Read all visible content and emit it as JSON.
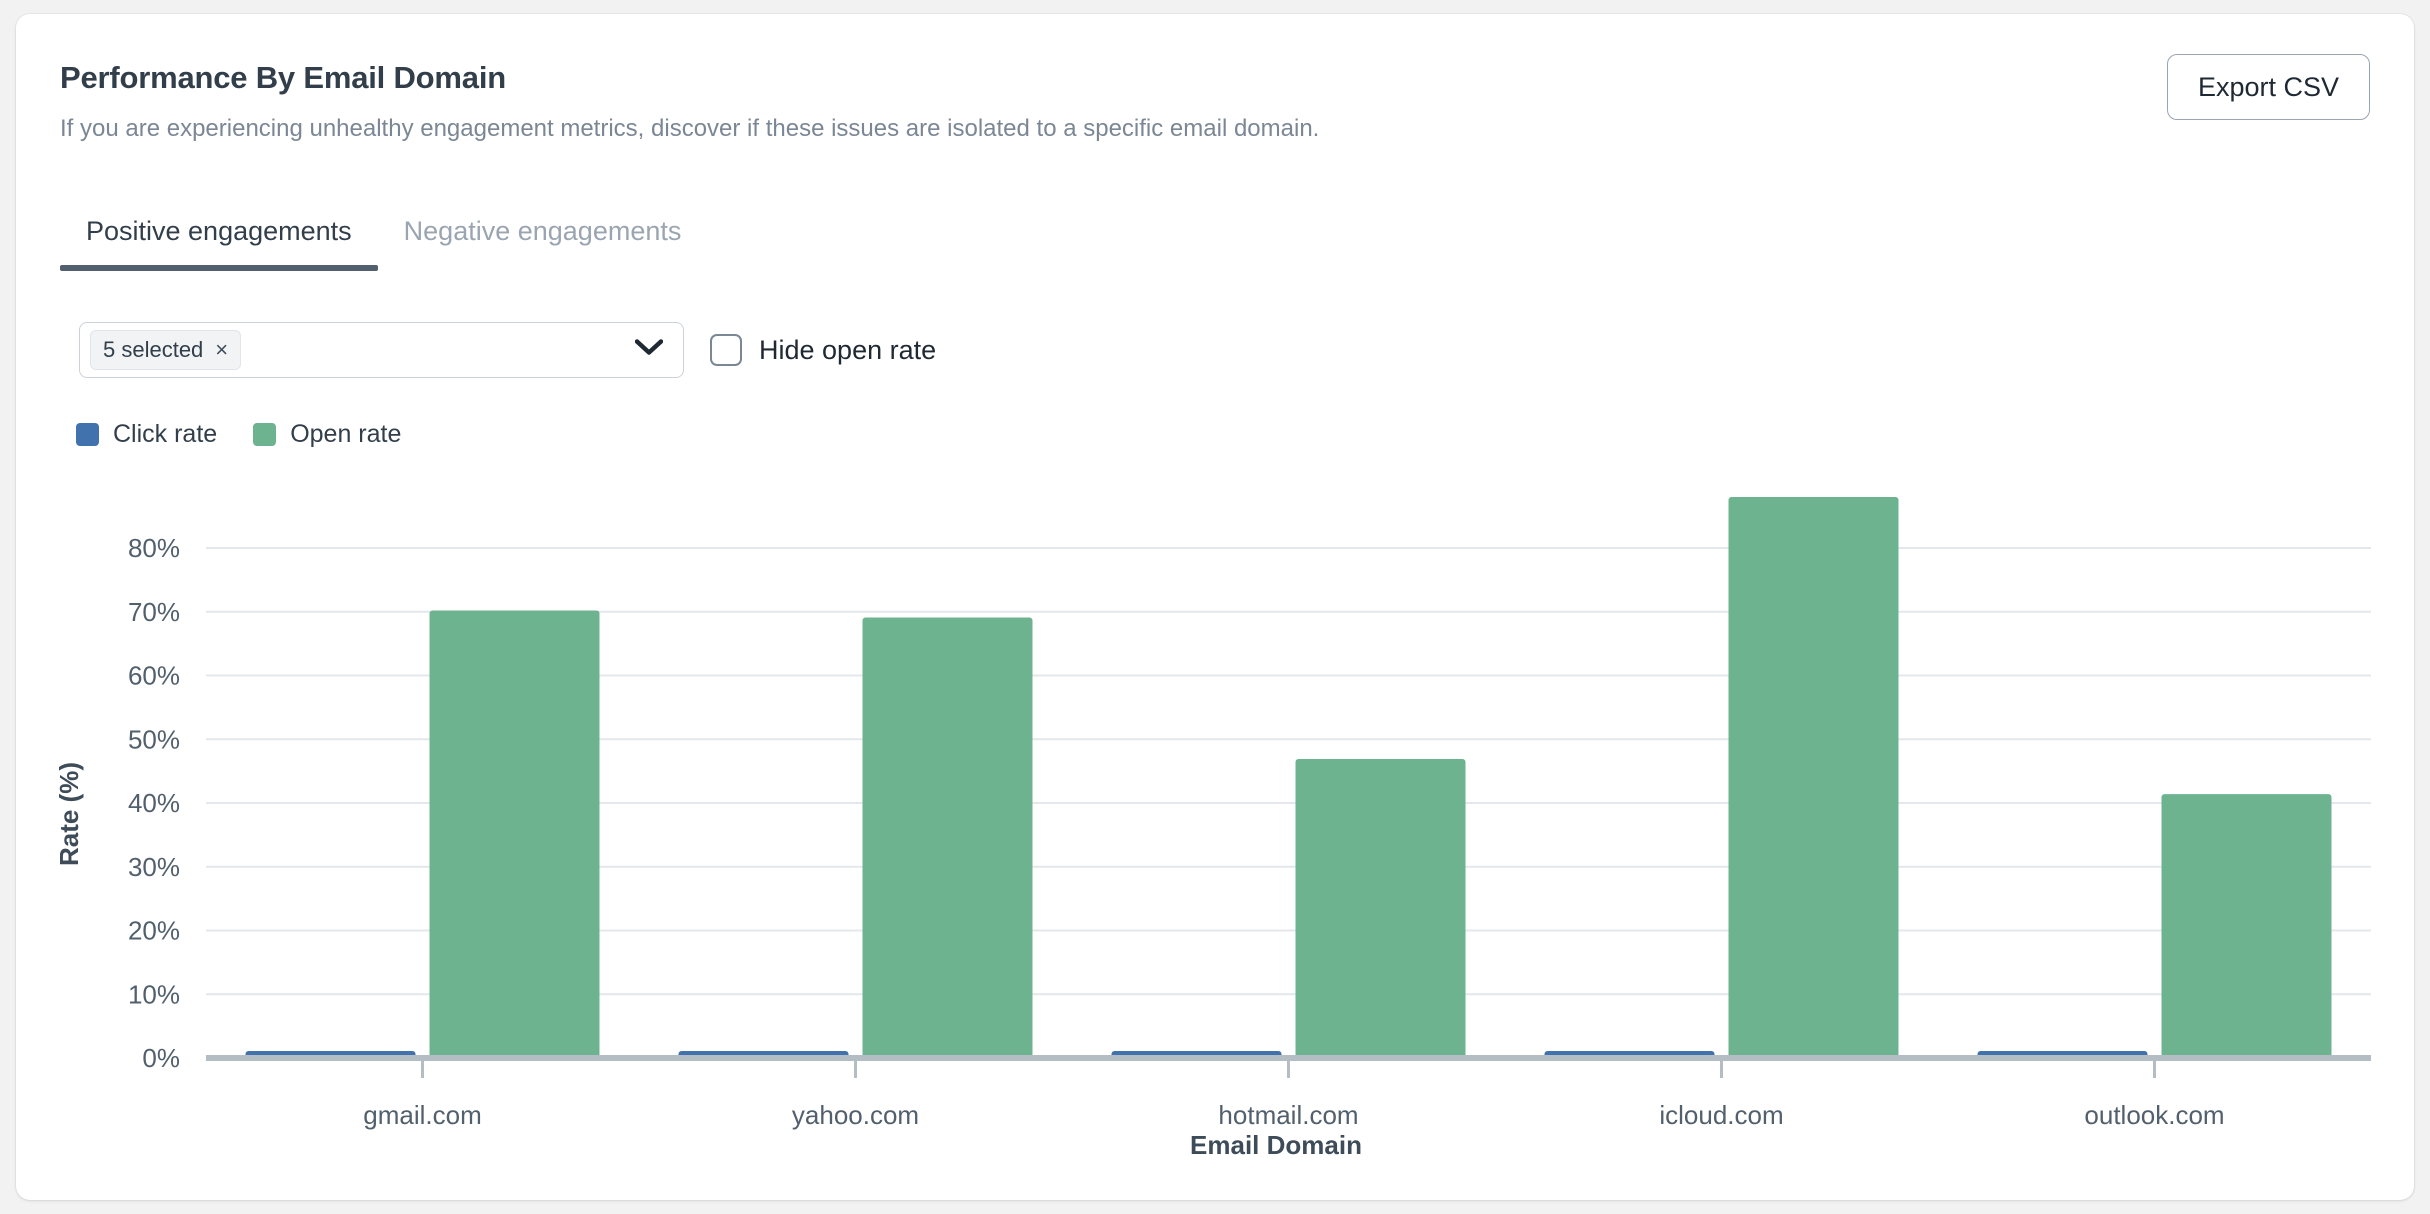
{
  "card": {
    "title": "Performance By Email Domain",
    "subtitle": "If you are experiencing unhealthy engagement metrics, discover if these issues are isolated to a specific email domain.",
    "export_button_label": "Export CSV"
  },
  "tabs": [
    {
      "label": "Positive engagements",
      "active": true
    },
    {
      "label": "Negative engagements",
      "active": false
    }
  ],
  "controls": {
    "domain_select": {
      "chip_label": "5 selected",
      "chip_remove_icon": "×",
      "chevron_icon": "chevron-down-icon"
    },
    "hide_open_rate": {
      "label": "Hide open rate",
      "checked": false
    }
  },
  "legend": [
    {
      "label": "Click rate",
      "color": "#4272ae"
    },
    {
      "label": "Open rate",
      "color": "#6eb390"
    }
  ],
  "chart_data": {
    "type": "bar",
    "title": "",
    "xlabel": "Email Domain",
    "ylabel": "Rate (%)",
    "categories": [
      "gmail.com",
      "yahoo.com",
      "hotmail.com",
      "icloud.com",
      "outlook.com"
    ],
    "series": [
      {
        "name": "Click rate",
        "color": "#4272ae",
        "values": [
          1.0,
          1.0,
          1.0,
          1.0,
          1.0
        ]
      },
      {
        "name": "Open rate",
        "color": "#6eb390",
        "values": [
          70.2,
          69.1,
          46.9,
          88.0,
          41.4
        ]
      }
    ],
    "ylim": [
      0,
      85
    ],
    "ytick_values": [
      0,
      10,
      20,
      30,
      40,
      50,
      60,
      70,
      80
    ],
    "ytick_labels": [
      "0%",
      "10%",
      "20%",
      "30%",
      "40%",
      "50%",
      "60%",
      "70%",
      "80%"
    ],
    "grid": true,
    "legend_position": "top-left"
  }
}
